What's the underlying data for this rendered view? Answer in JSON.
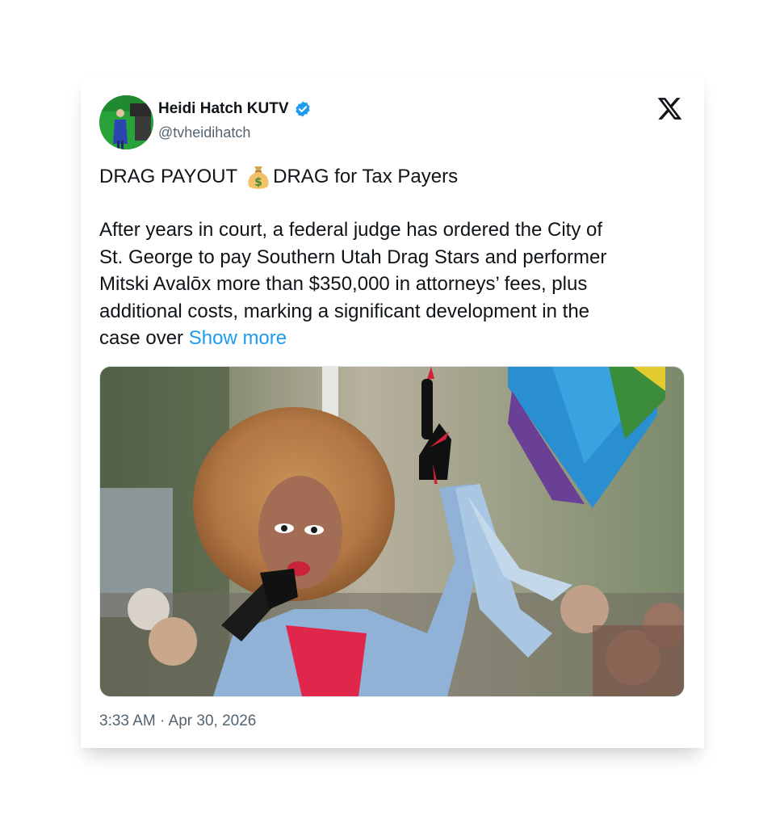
{
  "author": {
    "name": "Heidi Hatch KUTV",
    "handle": "@tvheidihatch",
    "verified": true,
    "avatar_icon": "profile-avatar"
  },
  "platform_icon": "x-logo-icon",
  "post": {
    "headline_part1": "DRAG PAYOUT",
    "headline_emoji_icon": "money-bag-icon",
    "headline_part2": "DRAG for Tax Payers",
    "body_lines": [
      "After years in court, a federal judge has ordered the City of",
      "St. George to pay Southern Utah Drag Stars and performer",
      "Mitski Avalōx more than $350,000 in attorneys’ fees, plus",
      "additional costs, marking a significant development in the",
      "case over"
    ],
    "show_more_label": "Show more",
    "media_icon": "photo-drag-performer-image",
    "timestamp": "3:33 AM · Apr 30, 2026"
  },
  "colors": {
    "text": "#0f1419",
    "secondary": "#536471",
    "link": "#1d9bf0",
    "verified": "#1d9bf0"
  }
}
